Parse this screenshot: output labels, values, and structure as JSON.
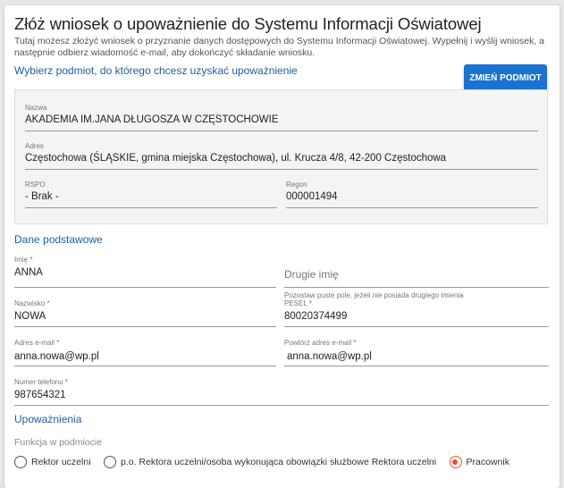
{
  "title": "Złóż wniosek o upoważnienie do Systemu Informacji Oświatowej",
  "description": "Tutaj możesz złożyć wniosek o przyznanie danych dostępowych do Systemu Informacji Oświatowej. Wypełnij i wyślij wniosek, a następnie odbierz wiadomość e-mail, aby dokończyć składanie wniosku.",
  "entity": {
    "section": "Wybierz podmiot, do którego chcesz uzyskać upoważnienie",
    "change_button": "ZMIEŃ PODMIOT",
    "name_label": "Nazwa",
    "name": "AKADEMIA IM.JANA DŁUGOSZA W CZĘSTOCHOWIE",
    "address_label": "Adres",
    "address": "Częstochowa (ŚLĄSKIE, gmina miejska Częstochowa), ul. Krucza 4/8, 42-200 Częstochowa",
    "rspo_label": "RSPO",
    "rspo": "- Brak -",
    "regon_label": "Regon",
    "regon": "000001494"
  },
  "basic": {
    "section": "Dane podstawowe",
    "first_name_label": "Imię *",
    "first_name": "ANNA",
    "second_name_placeholder": "Drugie imię",
    "second_name_hint": "Pozostaw puste pole, jeżeli nie posiada drugiego imienia",
    "last_name_label": "Nazwisko *",
    "last_name": "NOWA",
    "pesel_label": "PESEL *",
    "pesel": "80020374499",
    "email_label": "Adres e-mail *",
    "email": "anna.nowa@wp.pl",
    "email2_label": "Powtórz adres e-mail *",
    "email2": "anna.nowa@wp.pl",
    "phone_label": "Numer telefonu *",
    "phone": "987654321"
  },
  "auth": {
    "section": "Upoważnienia",
    "function_label": "Funkcja w podmiocie",
    "options": [
      {
        "label": "Rektor uczelni",
        "selected": false
      },
      {
        "label": "p.o. Rektora uczelni/osoba wykonująca obowiązki służbowe Rektora uczelni",
        "selected": false
      },
      {
        "label": "Pracownik",
        "selected": true
      }
    ]
  },
  "colors": {
    "accent": "#1a73d0",
    "radio_selected": "#e8522e"
  }
}
